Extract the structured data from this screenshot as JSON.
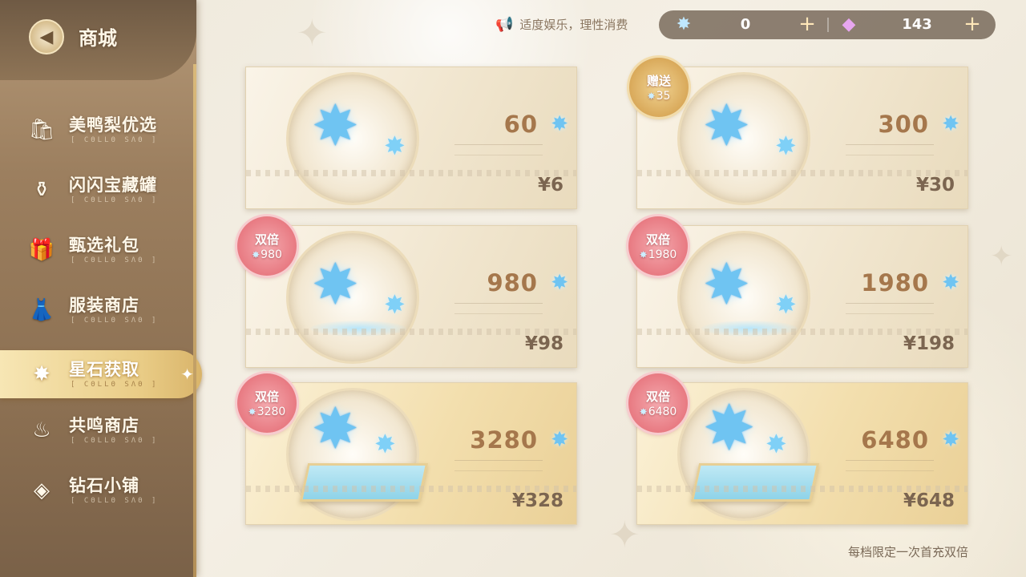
{
  "header": {
    "title": "商城",
    "notice": "适度娱乐，理性消费",
    "currencies": [
      {
        "icon": "star-crystal-icon",
        "value": "0"
      },
      {
        "icon": "pink-gem-icon",
        "value": "143"
      }
    ]
  },
  "sidebar": {
    "items": [
      {
        "label": "美鸭梨优选",
        "sub": "[ CΘLLΘ SΛΘ ]",
        "icon": "gift-bag-icon",
        "active": false
      },
      {
        "label": "闪闪宝藏罐",
        "sub": "[ CΘLLΘ SΛΘ ]",
        "icon": "treasure-jar-icon",
        "active": false
      },
      {
        "label": "甄选礼包",
        "sub": "[ CΘLLΘ SΛΘ ]",
        "icon": "gift-box-icon",
        "active": false
      },
      {
        "label": "服装商店",
        "sub": "[ CΘLLΘ SΛΘ ]",
        "icon": "dress-icon",
        "active": false
      },
      {
        "label": "星石获取",
        "sub": "[ CΘLLΘ SΛΘ ]",
        "icon": "star-stone-icon",
        "active": true
      },
      {
        "label": "共鸣商店",
        "sub": "[ CΘLLΘ SΛΘ ]",
        "icon": "resonance-icon",
        "active": false
      },
      {
        "label": "钻石小铺",
        "sub": "[ CΘLLΘ SΛΘ ]",
        "icon": "diamond-shop-icon",
        "active": false
      }
    ]
  },
  "products": [
    {
      "amount": "60",
      "price": "¥6",
      "badge": null
    },
    {
      "amount": "300",
      "price": "¥30",
      "badge": {
        "type": "gift",
        "title": "赠送",
        "value": "35"
      }
    },
    {
      "amount": "980",
      "price": "¥98",
      "badge": {
        "type": "double",
        "title": "双倍",
        "value": "980"
      }
    },
    {
      "amount": "1980",
      "price": "¥198",
      "badge": {
        "type": "double",
        "title": "双倍",
        "value": "1980"
      }
    },
    {
      "amount": "3280",
      "price": "¥328",
      "badge": {
        "type": "double",
        "title": "双倍",
        "value": "3280"
      }
    },
    {
      "amount": "6480",
      "price": "¥648",
      "badge": {
        "type": "double",
        "title": "双倍",
        "value": "6480"
      }
    }
  ],
  "footer": {
    "note": "每档限定一次首充双倍"
  },
  "colors": {
    "sidebar": "#9c7f5f",
    "active_tab": "#e9cc86",
    "badge_double": "#e87a82",
    "badge_gift": "#d9a95a",
    "crystal": "#6fc4f2",
    "amount_text": "#a5774c"
  }
}
